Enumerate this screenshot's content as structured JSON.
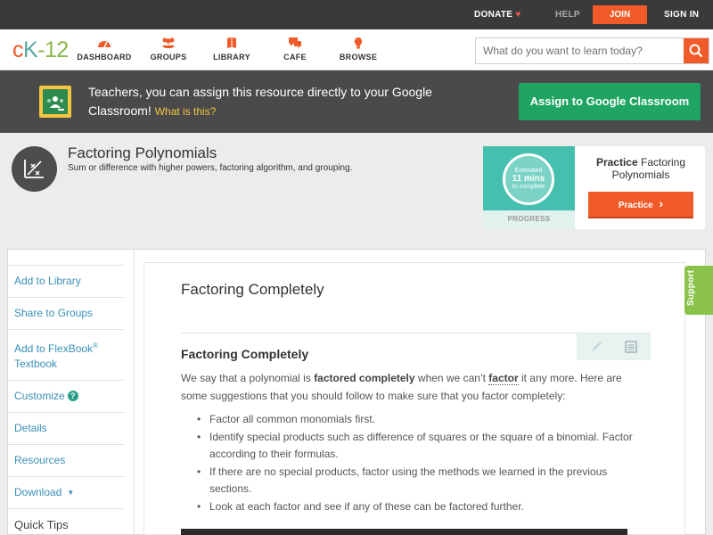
{
  "topbar": {
    "donate": "DONATE",
    "heart": "♥",
    "help": "HELP",
    "join": "JOIN",
    "signin": "SIGN IN"
  },
  "brand": {
    "c": "c",
    "k": "K",
    "dash": "-",
    "num": "12"
  },
  "nav": {
    "dashboard": "DASHBOARD",
    "groups": "GROUPS",
    "library": "LIBRARY",
    "cafe": "CAFE",
    "browse": "BROWSE"
  },
  "search": {
    "placeholder": "What do you want to learn today?"
  },
  "classroom": {
    "text": "Teachers, you can assign this resource directly to your Google Classroom!",
    "what": "What is this?",
    "button": "Assign to Google Classroom"
  },
  "concept": {
    "title": "Factoring Polynomials",
    "subtitle": "Sum or difference with higher powers, factoring algorithm, and grouping."
  },
  "practice": {
    "est_line1": "Estimated",
    "est_line2": "11 mins",
    "est_line3": "to complete",
    "progress": "PROGRESS",
    "title_bold": "Practice",
    "title_rest": "Factoring Polynomials",
    "button": "Practice",
    "button_arrow": "›"
  },
  "sidebar": {
    "add_library": "Add to Library",
    "share_groups": "Share to Groups",
    "add_flexbook": "Add to FlexBook",
    "reg": "®",
    "textbook": "Textbook",
    "customize": "Customize",
    "customize_badge": "?",
    "details": "Details",
    "resources": "Resources",
    "download": "Download",
    "download_caret": "▼",
    "quick_tips": "Quick Tips"
  },
  "content": {
    "title": "Factoring Completely",
    "heading": "Factoring Completely",
    "p_pre": "We say that a polynomial is ",
    "p_bold": "factored completely",
    "p_mid": " when we can’t ",
    "p_factor": "factor",
    "p_post": " it any more. Here are some suggestions that you should follow to make sure that you factor completely:",
    "bullets": [
      "Factor all common monomials first.",
      "Identify special products such as difference of squares or the square of a binomial. Factor according to their formulas.",
      "If there are no special products, factor using the methods we learned in the previous sections.",
      "Look at each factor and see if any of these can be factored further."
    ]
  },
  "support": "Support",
  "colors": {
    "accent_orange": "#f15a29",
    "google_green": "#1fa463",
    "link_blue": "#3a8fb7",
    "support_green": "#8bc34a"
  },
  "icons": [
    "heart-icon",
    "dashboard-icon",
    "groups-icon",
    "library-icon",
    "cafe-icon",
    "browse-icon",
    "search-icon",
    "google-classroom-icon",
    "concept-chart-icon",
    "pencil-icon",
    "notes-icon"
  ]
}
